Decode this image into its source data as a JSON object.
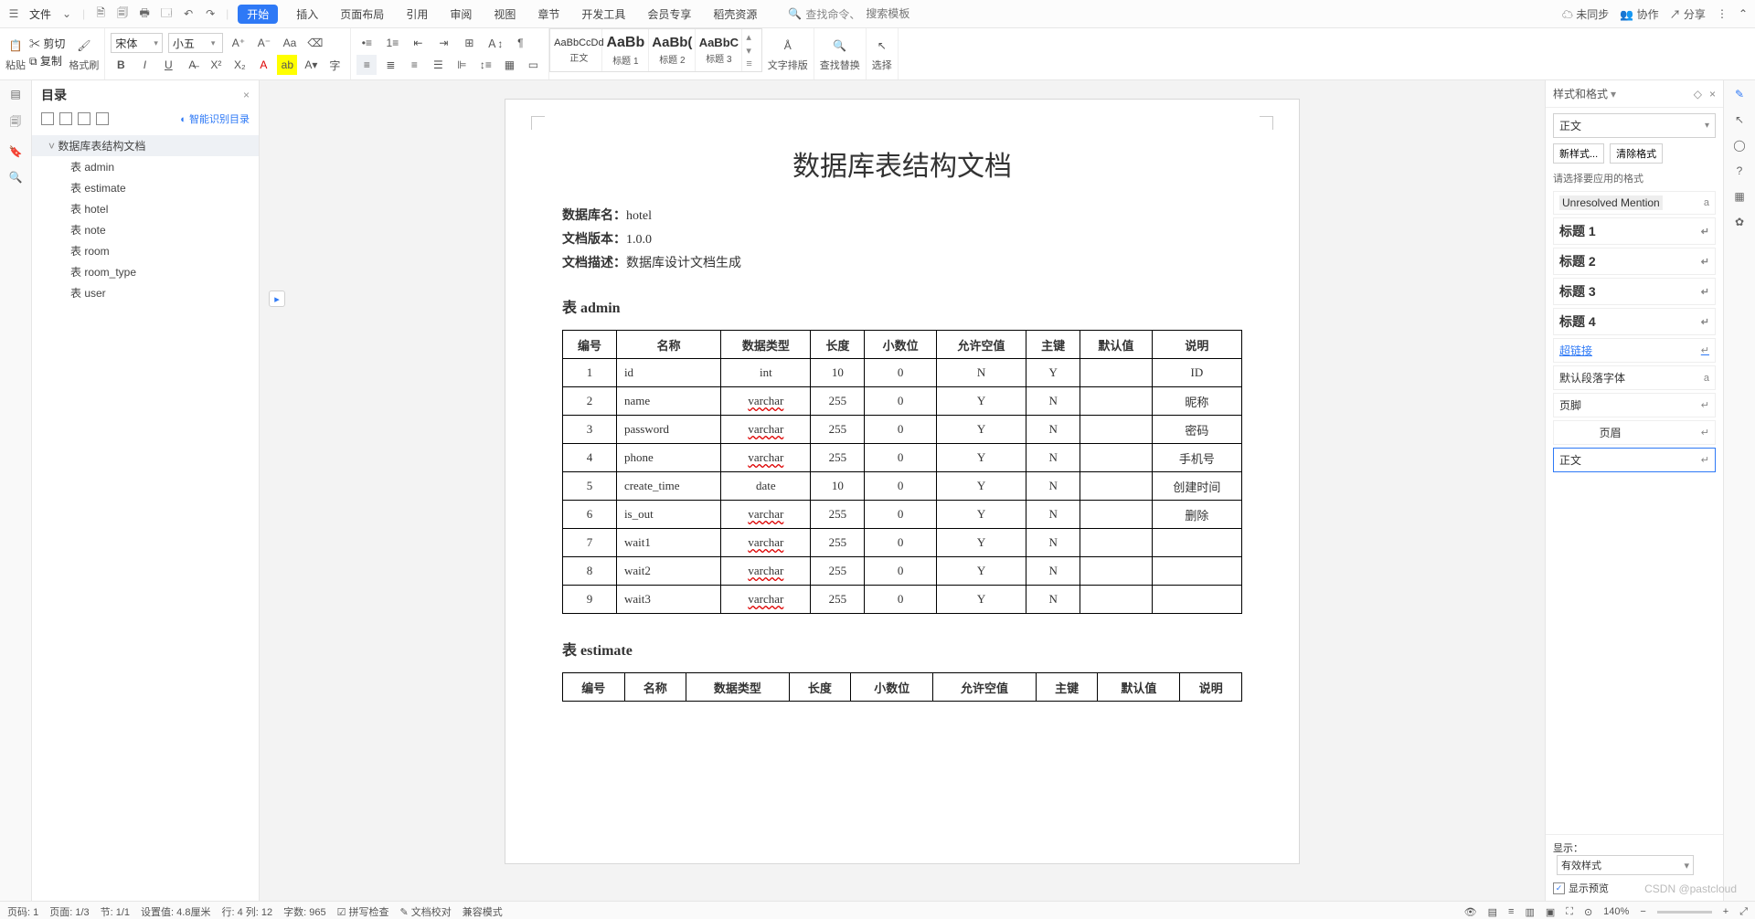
{
  "topbar": {
    "file_menu": "文件",
    "tabs": [
      "开始",
      "插入",
      "页面布局",
      "引用",
      "审阅",
      "视图",
      "章节",
      "开发工具",
      "会员专享",
      "稻壳资源"
    ],
    "active_tab": 0,
    "search_prefix": "查找命令、",
    "search_placeholder": "搜索模板",
    "sync": "未同步",
    "collab": "协作",
    "share": "分享"
  },
  "ribbon": {
    "paste": "粘贴",
    "cut": "剪切",
    "copy": "复制",
    "format_painter": "格式刷",
    "font_name": "宋体",
    "font_size": "小五",
    "style_gallery": [
      {
        "preview": "AaBbCcDd",
        "name": "正文"
      },
      {
        "preview": "AaBb",
        "name": "标题 1"
      },
      {
        "preview": "AaBb(",
        "name": "标题 2"
      },
      {
        "preview": "AaBbC",
        "name": "标题 3"
      }
    ],
    "text_layout": "文字排版",
    "find_replace": "查找替换",
    "select": "选择"
  },
  "outline": {
    "title": "目录",
    "smart": "智能识别目录",
    "items": [
      {
        "label": "数据库表结构文档",
        "level": 0
      },
      {
        "label": "表 admin",
        "level": 1
      },
      {
        "label": "表 estimate",
        "level": 1
      },
      {
        "label": "表 hotel",
        "level": 1
      },
      {
        "label": "表 note",
        "level": 1
      },
      {
        "label": "表 room",
        "level": 1
      },
      {
        "label": "表 room_type",
        "level": 1
      },
      {
        "label": "表 user",
        "level": 1
      }
    ]
  },
  "document": {
    "title": "数据库表结构文档",
    "meta": {
      "db_label": "数据库名：",
      "db_value": "hotel",
      "ver_label": "文档版本：",
      "ver_value": "1.0.0",
      "desc_label": "文档描述：",
      "desc_value": "数据库设计文档生成"
    },
    "table_headers": [
      "编号",
      "名称",
      "数据类型",
      "长度",
      "小数位",
      "允许空值",
      "主键",
      "默认值",
      "说明"
    ],
    "sections": [
      {
        "title": "表 admin",
        "rows": [
          [
            "1",
            "id",
            "int",
            "10",
            "0",
            "N",
            "Y",
            "",
            "ID"
          ],
          [
            "2",
            "name",
            "varchar",
            "255",
            "0",
            "Y",
            "N",
            "",
            "昵称"
          ],
          [
            "3",
            "password",
            "varchar",
            "255",
            "0",
            "Y",
            "N",
            "",
            "密码"
          ],
          [
            "4",
            "phone",
            "varchar",
            "255",
            "0",
            "Y",
            "N",
            "",
            "手机号"
          ],
          [
            "5",
            "create_time",
            "date",
            "10",
            "0",
            "Y",
            "N",
            "",
            "创建时间"
          ],
          [
            "6",
            "is_out",
            "varchar",
            "255",
            "0",
            "Y",
            "N",
            "",
            "删除"
          ],
          [
            "7",
            "wait1",
            "varchar",
            "255",
            "0",
            "Y",
            "N",
            "",
            ""
          ],
          [
            "8",
            "wait2",
            "varchar",
            "255",
            "0",
            "Y",
            "N",
            "",
            ""
          ],
          [
            "9",
            "wait3",
            "varchar",
            "255",
            "0",
            "Y",
            "N",
            "",
            ""
          ]
        ]
      },
      {
        "title": "表 estimate",
        "rows": []
      }
    ]
  },
  "styles_panel": {
    "title": "样式和格式",
    "current": "正文",
    "new_style": "新样式...",
    "clear": "清除格式",
    "hint": "请选择要应用的格式",
    "list": [
      {
        "label": "Unresolved Mention",
        "type": "char"
      },
      {
        "label": "标题 1",
        "type": "h"
      },
      {
        "label": "标题 2",
        "type": "h"
      },
      {
        "label": "标题 3",
        "type": "h"
      },
      {
        "label": "标题 4",
        "type": "h"
      },
      {
        "label": "超链接",
        "type": "link"
      },
      {
        "label": "默认段落字体",
        "type": "char"
      },
      {
        "label": "页脚",
        "type": "para"
      },
      {
        "label": "页眉",
        "type": "para-center"
      },
      {
        "label": "正文",
        "type": "para",
        "selected": true
      }
    ],
    "show_label": "显示：",
    "show_value": "有效样式",
    "preview_chk": "显示预览"
  },
  "status": {
    "page_no": "页码: 1",
    "page": "页面: 1/3",
    "section": "节: 1/1",
    "pos": "设置值: 4.8厘米",
    "rowcol": "行: 4  列: 12",
    "wc": "字数: 965",
    "ime": "拼写检查",
    "docfix": "文档校对",
    "compat": "兼容模式",
    "zoom": "140%",
    "watermark": "CSDN @pastcloud"
  }
}
